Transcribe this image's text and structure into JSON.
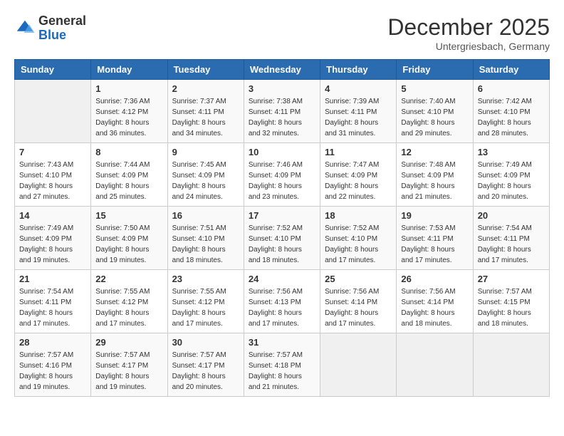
{
  "header": {
    "logo_general": "General",
    "logo_blue": "Blue",
    "month_title": "December 2025",
    "location": "Untergriesbach, Germany"
  },
  "calendar": {
    "days_of_week": [
      "Sunday",
      "Monday",
      "Tuesday",
      "Wednesday",
      "Thursday",
      "Friday",
      "Saturday"
    ],
    "weeks": [
      [
        {
          "day": "",
          "empty": true
        },
        {
          "day": "1",
          "sunrise": "Sunrise: 7:36 AM",
          "sunset": "Sunset: 4:12 PM",
          "daylight": "Daylight: 8 hours and 36 minutes."
        },
        {
          "day": "2",
          "sunrise": "Sunrise: 7:37 AM",
          "sunset": "Sunset: 4:11 PM",
          "daylight": "Daylight: 8 hours and 34 minutes."
        },
        {
          "day": "3",
          "sunrise": "Sunrise: 7:38 AM",
          "sunset": "Sunset: 4:11 PM",
          "daylight": "Daylight: 8 hours and 32 minutes."
        },
        {
          "day": "4",
          "sunrise": "Sunrise: 7:39 AM",
          "sunset": "Sunset: 4:11 PM",
          "daylight": "Daylight: 8 hours and 31 minutes."
        },
        {
          "day": "5",
          "sunrise": "Sunrise: 7:40 AM",
          "sunset": "Sunset: 4:10 PM",
          "daylight": "Daylight: 8 hours and 29 minutes."
        },
        {
          "day": "6",
          "sunrise": "Sunrise: 7:42 AM",
          "sunset": "Sunset: 4:10 PM",
          "daylight": "Daylight: 8 hours and 28 minutes."
        }
      ],
      [
        {
          "day": "7",
          "sunrise": "Sunrise: 7:43 AM",
          "sunset": "Sunset: 4:10 PM",
          "daylight": "Daylight: 8 hours and 27 minutes."
        },
        {
          "day": "8",
          "sunrise": "Sunrise: 7:44 AM",
          "sunset": "Sunset: 4:09 PM",
          "daylight": "Daylight: 8 hours and 25 minutes."
        },
        {
          "day": "9",
          "sunrise": "Sunrise: 7:45 AM",
          "sunset": "Sunset: 4:09 PM",
          "daylight": "Daylight: 8 hours and 24 minutes."
        },
        {
          "day": "10",
          "sunrise": "Sunrise: 7:46 AM",
          "sunset": "Sunset: 4:09 PM",
          "daylight": "Daylight: 8 hours and 23 minutes."
        },
        {
          "day": "11",
          "sunrise": "Sunrise: 7:47 AM",
          "sunset": "Sunset: 4:09 PM",
          "daylight": "Daylight: 8 hours and 22 minutes."
        },
        {
          "day": "12",
          "sunrise": "Sunrise: 7:48 AM",
          "sunset": "Sunset: 4:09 PM",
          "daylight": "Daylight: 8 hours and 21 minutes."
        },
        {
          "day": "13",
          "sunrise": "Sunrise: 7:49 AM",
          "sunset": "Sunset: 4:09 PM",
          "daylight": "Daylight: 8 hours and 20 minutes."
        }
      ],
      [
        {
          "day": "14",
          "sunrise": "Sunrise: 7:49 AM",
          "sunset": "Sunset: 4:09 PM",
          "daylight": "Daylight: 8 hours and 19 minutes."
        },
        {
          "day": "15",
          "sunrise": "Sunrise: 7:50 AM",
          "sunset": "Sunset: 4:09 PM",
          "daylight": "Daylight: 8 hours and 19 minutes."
        },
        {
          "day": "16",
          "sunrise": "Sunrise: 7:51 AM",
          "sunset": "Sunset: 4:10 PM",
          "daylight": "Daylight: 8 hours and 18 minutes."
        },
        {
          "day": "17",
          "sunrise": "Sunrise: 7:52 AM",
          "sunset": "Sunset: 4:10 PM",
          "daylight": "Daylight: 8 hours and 18 minutes."
        },
        {
          "day": "18",
          "sunrise": "Sunrise: 7:52 AM",
          "sunset": "Sunset: 4:10 PM",
          "daylight": "Daylight: 8 hours and 17 minutes."
        },
        {
          "day": "19",
          "sunrise": "Sunrise: 7:53 AM",
          "sunset": "Sunset: 4:11 PM",
          "daylight": "Daylight: 8 hours and 17 minutes."
        },
        {
          "day": "20",
          "sunrise": "Sunrise: 7:54 AM",
          "sunset": "Sunset: 4:11 PM",
          "daylight": "Daylight: 8 hours and 17 minutes."
        }
      ],
      [
        {
          "day": "21",
          "sunrise": "Sunrise: 7:54 AM",
          "sunset": "Sunset: 4:11 PM",
          "daylight": "Daylight: 8 hours and 17 minutes."
        },
        {
          "day": "22",
          "sunrise": "Sunrise: 7:55 AM",
          "sunset": "Sunset: 4:12 PM",
          "daylight": "Daylight: 8 hours and 17 minutes."
        },
        {
          "day": "23",
          "sunrise": "Sunrise: 7:55 AM",
          "sunset": "Sunset: 4:12 PM",
          "daylight": "Daylight: 8 hours and 17 minutes."
        },
        {
          "day": "24",
          "sunrise": "Sunrise: 7:56 AM",
          "sunset": "Sunset: 4:13 PM",
          "daylight": "Daylight: 8 hours and 17 minutes."
        },
        {
          "day": "25",
          "sunrise": "Sunrise: 7:56 AM",
          "sunset": "Sunset: 4:14 PM",
          "daylight": "Daylight: 8 hours and 17 minutes."
        },
        {
          "day": "26",
          "sunrise": "Sunrise: 7:56 AM",
          "sunset": "Sunset: 4:14 PM",
          "daylight": "Daylight: 8 hours and 18 minutes."
        },
        {
          "day": "27",
          "sunrise": "Sunrise: 7:57 AM",
          "sunset": "Sunset: 4:15 PM",
          "daylight": "Daylight: 8 hours and 18 minutes."
        }
      ],
      [
        {
          "day": "28",
          "sunrise": "Sunrise: 7:57 AM",
          "sunset": "Sunset: 4:16 PM",
          "daylight": "Daylight: 8 hours and 19 minutes."
        },
        {
          "day": "29",
          "sunrise": "Sunrise: 7:57 AM",
          "sunset": "Sunset: 4:17 PM",
          "daylight": "Daylight: 8 hours and 19 minutes."
        },
        {
          "day": "30",
          "sunrise": "Sunrise: 7:57 AM",
          "sunset": "Sunset: 4:17 PM",
          "daylight": "Daylight: 8 hours and 20 minutes."
        },
        {
          "day": "31",
          "sunrise": "Sunrise: 7:57 AM",
          "sunset": "Sunset: 4:18 PM",
          "daylight": "Daylight: 8 hours and 21 minutes."
        },
        {
          "day": "",
          "empty": true
        },
        {
          "day": "",
          "empty": true
        },
        {
          "day": "",
          "empty": true
        }
      ]
    ]
  }
}
